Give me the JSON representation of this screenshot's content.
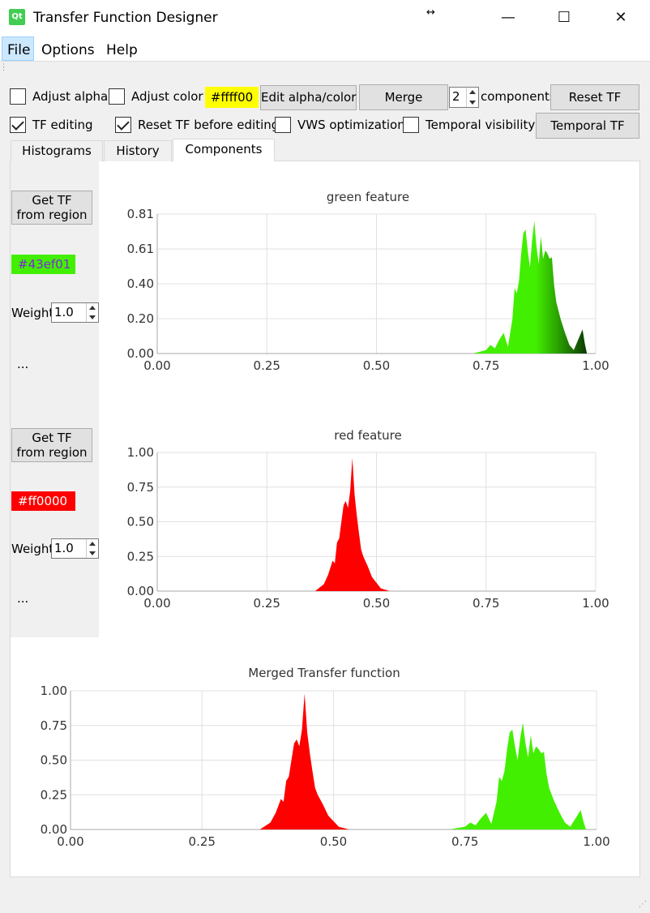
{
  "window": {
    "title": "Transfer Function Designer",
    "logo_text": "Qt",
    "resize_cursor": "↔",
    "minimize_glyph": "—",
    "maximize_glyph": "☐",
    "close_glyph": "✕"
  },
  "menu": {
    "file": "File",
    "options": "Options",
    "help": "Help"
  },
  "toolbar": {
    "adjust_alpha": "Adjust alpha",
    "adjust_color": "Adjust color",
    "color_value": "#ffff00",
    "color_hex": "#ffff00",
    "edit_alpha_color": "Edit alpha/color",
    "merge": "Merge",
    "components_count": "2",
    "components_label": "components",
    "reset_tf": "Reset TF",
    "tf_editing": "TF editing",
    "reset_tf_before_editing": "Reset TF before editing",
    "vws_optimization": "VWS optimization",
    "temporal_visibility": "Temporal visibility",
    "temporal_tf": "Temporal TF",
    "checks": {
      "adjust_alpha": false,
      "adjust_color": false,
      "tf_editing": true,
      "reset_tf_before_editing": true,
      "vws_optimization": false,
      "temporal_visibility": false
    }
  },
  "tabs": {
    "histograms": "Histograms",
    "history": "History",
    "components": "Components",
    "active": "Components"
  },
  "components": [
    {
      "get_tf_line1": "Get TF",
      "get_tf_line2": "from region",
      "color_label": "#43ef01",
      "color_hex": "#43ef01",
      "text_color": "#7a2bd9",
      "weight_label": "Weight",
      "weight_value": "1.0",
      "more": "..."
    },
    {
      "get_tf_line1": "Get TF",
      "get_tf_line2": "from region",
      "color_label": "#ff0000",
      "color_hex": "#ff0000",
      "text_color": "#ffffff",
      "weight_label": "Weight",
      "weight_value": "1.0",
      "more": "..."
    }
  ],
  "chart_data": [
    {
      "type": "area",
      "title": "green feature",
      "xlim": [
        0,
        1
      ],
      "ylim": [
        0,
        0.81
      ],
      "x_ticks": [
        "0.00",
        "0.25",
        "0.50",
        "0.75",
        "1.00"
      ],
      "y_ticks": [
        "0.00",
        "0.20",
        "0.40",
        "0.61",
        "0.81"
      ],
      "grid": true,
      "series": [
        {
          "color_start": "#43ef01",
          "color_end": "#0a3a00",
          "x": [
            0.72,
            0.75,
            0.76,
            0.77,
            0.78,
            0.79,
            0.8,
            0.81,
            0.815,
            0.82,
            0.825,
            0.83,
            0.835,
            0.84,
            0.845,
            0.85,
            0.855,
            0.86,
            0.865,
            0.87,
            0.875,
            0.88,
            0.885,
            0.89,
            0.895,
            0.9,
            0.905,
            0.91,
            0.92,
            0.93,
            0.94,
            0.95,
            0.96,
            0.97,
            0.975,
            0.98
          ],
          "y": [
            0.0,
            0.02,
            0.05,
            0.03,
            0.08,
            0.12,
            0.04,
            0.2,
            0.38,
            0.35,
            0.42,
            0.58,
            0.7,
            0.72,
            0.6,
            0.5,
            0.66,
            0.77,
            0.62,
            0.52,
            0.68,
            0.55,
            0.6,
            0.58,
            0.55,
            0.56,
            0.4,
            0.3,
            0.2,
            0.12,
            0.05,
            0.02,
            0.08,
            0.14,
            0.06,
            0.0
          ]
        }
      ]
    },
    {
      "type": "area",
      "title": "red feature",
      "xlim": [
        0,
        1
      ],
      "ylim": [
        0,
        1
      ],
      "x_ticks": [
        "0.00",
        "0.25",
        "0.50",
        "0.75",
        "1.00"
      ],
      "y_ticks": [
        "0.00",
        "0.25",
        "0.50",
        "0.75",
        "1.00"
      ],
      "grid": true,
      "series": [
        {
          "color": "#ff0000",
          "x": [
            0.36,
            0.38,
            0.39,
            0.4,
            0.405,
            0.41,
            0.415,
            0.42,
            0.425,
            0.43,
            0.435,
            0.44,
            0.445,
            0.45,
            0.455,
            0.46,
            0.465,
            0.47,
            0.48,
            0.49,
            0.5,
            0.51,
            0.53
          ],
          "y": [
            0.0,
            0.05,
            0.12,
            0.22,
            0.2,
            0.35,
            0.38,
            0.5,
            0.62,
            0.65,
            0.6,
            0.72,
            0.96,
            0.7,
            0.55,
            0.42,
            0.3,
            0.25,
            0.18,
            0.1,
            0.06,
            0.02,
            0.0
          ]
        }
      ]
    },
    {
      "type": "area",
      "title": "Merged Transfer function",
      "xlim": [
        0,
        1
      ],
      "ylim": [
        0,
        1
      ],
      "x_ticks": [
        "0.00",
        "0.25",
        "0.50",
        "0.75",
        "1.00"
      ],
      "y_ticks": [
        "0.00",
        "0.25",
        "0.50",
        "0.75",
        "1.00"
      ],
      "grid": true,
      "series": [
        {
          "color": "#ff0000",
          "x": [
            0.36,
            0.38,
            0.39,
            0.4,
            0.405,
            0.41,
            0.415,
            0.42,
            0.425,
            0.43,
            0.435,
            0.44,
            0.445,
            0.45,
            0.455,
            0.46,
            0.465,
            0.47,
            0.48,
            0.49,
            0.5,
            0.51,
            0.53
          ],
          "y": [
            0.0,
            0.05,
            0.12,
            0.22,
            0.2,
            0.35,
            0.38,
            0.5,
            0.62,
            0.65,
            0.6,
            0.72,
            0.98,
            0.7,
            0.55,
            0.42,
            0.3,
            0.25,
            0.18,
            0.1,
            0.06,
            0.02,
            0.0
          ]
        },
        {
          "color": "#43ef01",
          "x": [
            0.72,
            0.75,
            0.76,
            0.77,
            0.78,
            0.79,
            0.8,
            0.81,
            0.815,
            0.82,
            0.825,
            0.83,
            0.835,
            0.84,
            0.845,
            0.85,
            0.855,
            0.86,
            0.865,
            0.87,
            0.875,
            0.88,
            0.885,
            0.89,
            0.895,
            0.9,
            0.905,
            0.91,
            0.92,
            0.93,
            0.94,
            0.95,
            0.96,
            0.97,
            0.975,
            0.98
          ],
          "y": [
            0.0,
            0.02,
            0.05,
            0.03,
            0.08,
            0.12,
            0.04,
            0.2,
            0.38,
            0.35,
            0.42,
            0.58,
            0.7,
            0.72,
            0.6,
            0.5,
            0.66,
            0.77,
            0.62,
            0.52,
            0.68,
            0.55,
            0.6,
            0.58,
            0.55,
            0.56,
            0.4,
            0.3,
            0.2,
            0.12,
            0.05,
            0.02,
            0.08,
            0.14,
            0.06,
            0.0
          ]
        }
      ]
    }
  ]
}
